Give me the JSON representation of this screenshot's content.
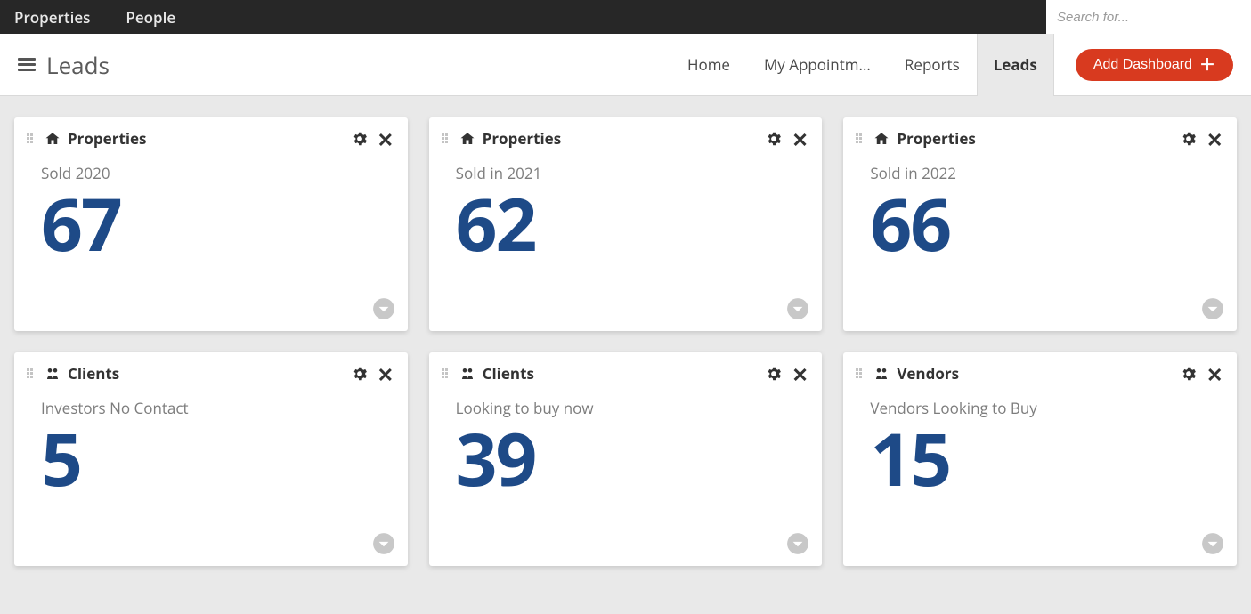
{
  "topbar": {
    "links": [
      "Properties",
      "People"
    ],
    "search_placeholder": "Search for..."
  },
  "subbar": {
    "page_title": "Leads",
    "nav": [
      "Home",
      "My Appointm...",
      "Reports",
      "Leads"
    ],
    "active_index": 3,
    "add_dashboard_label": "Add Dashboard"
  },
  "cards": [
    {
      "icon": "home",
      "title": "Properties",
      "subtext": "Sold 2020",
      "value": "67"
    },
    {
      "icon": "home",
      "title": "Properties",
      "subtext": "Sold in 2021",
      "value": "62"
    },
    {
      "icon": "home",
      "title": "Properties",
      "subtext": "Sold in 2022",
      "value": "66"
    },
    {
      "icon": "people",
      "title": "Clients",
      "subtext": "Investors No Contact",
      "value": "5"
    },
    {
      "icon": "people",
      "title": "Clients",
      "subtext": "Looking to buy now",
      "value": "39"
    },
    {
      "icon": "people",
      "title": "Vendors",
      "subtext": "Vendors Looking to Buy",
      "value": "15"
    }
  ]
}
